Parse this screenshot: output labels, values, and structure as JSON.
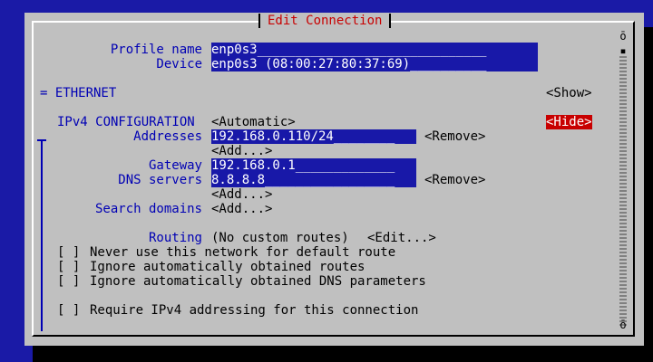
{
  "dialog": {
    "title": "Edit Connection"
  },
  "profile": {
    "label": "Profile name",
    "value": "enp0s3______________________________"
  },
  "device": {
    "label": "Device",
    "value": "enp0s3 (08:00:27:80:37:69)__________"
  },
  "ethernet": {
    "label": "= ETHERNET",
    "toggle": "<Show>"
  },
  "ipv4": {
    "label": "IPv4 CONFIGURATION",
    "mode": "<Automatic>",
    "toggle": "<Hide>",
    "addresses": {
      "label": "Addresses",
      "value": "192.168.0.110/24________",
      "remove": "<Remove>",
      "add": "<Add...>"
    },
    "gateway": {
      "label": "Gateway",
      "value": "192.168.0.1_____________"
    },
    "dns": {
      "label": "DNS servers",
      "value": "8.8.8.8_________________",
      "remove": "<Remove>",
      "add": "<Add...>"
    },
    "search": {
      "label": "Search domains",
      "add": "<Add...>"
    },
    "routing": {
      "label": "Routing",
      "value": "(No custom routes)",
      "edit": "<Edit...>"
    },
    "checks": [
      {
        "box": "[ ]",
        "label": "Never use this network for default route"
      },
      {
        "box": "[ ]",
        "label": "Ignore automatically obtained routes"
      },
      {
        "box": "[ ]",
        "label": "Ignore automatically obtained DNS parameters"
      }
    ],
    "require": {
      "box": "[ ]",
      "label": "Require IPv4 addressing for this connection"
    }
  },
  "scrollbar": {
    "up": "ō",
    "thumb": "▪",
    "down": "ō"
  },
  "colors": {
    "background": "#1a1aa6",
    "dialog": "#c0c0c0",
    "label": "#0000b4",
    "field": "#1818a8",
    "accent": "#c80000"
  }
}
